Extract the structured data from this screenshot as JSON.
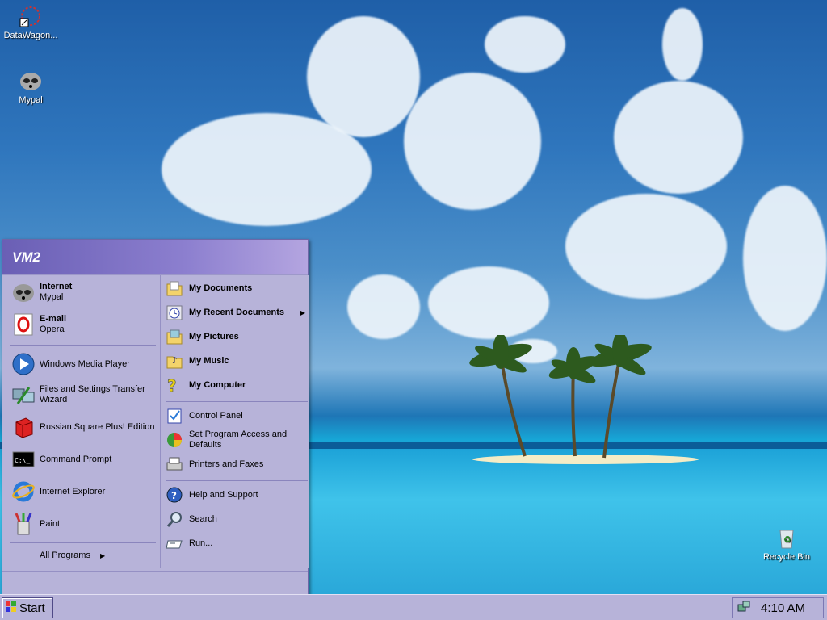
{
  "desktop": {
    "icons": [
      {
        "label": "DataWagon...",
        "icon": "datawagon-icon"
      },
      {
        "label": "Mypal",
        "icon": "mypal-icon"
      },
      {
        "label": "Recycle Bin",
        "icon": "recycle-bin-icon"
      }
    ]
  },
  "start_menu": {
    "user": "VM2",
    "pinned": [
      {
        "title": "Internet",
        "subtitle": "Mypal",
        "icon": "mypal-icon"
      },
      {
        "title": "E-mail",
        "subtitle": "Opera",
        "icon": "opera-icon"
      }
    ],
    "recent": [
      {
        "label": "Windows Media Player",
        "icon": "media-player-icon"
      },
      {
        "label": "Files and Settings Transfer Wizard",
        "icon": "transfer-wizard-icon"
      },
      {
        "label": "Russian Square Plus! Edition",
        "icon": "russian-square-icon"
      },
      {
        "label": "Command Prompt",
        "icon": "command-prompt-icon"
      },
      {
        "label": "Internet Explorer",
        "icon": "internet-explorer-icon"
      },
      {
        "label": "Paint",
        "icon": "paint-icon"
      }
    ],
    "all_programs": "All Programs",
    "right_top": [
      {
        "label": "My Documents",
        "icon": "folder-documents-icon"
      },
      {
        "label": "My Recent Documents",
        "icon": "recent-documents-icon"
      },
      {
        "label": "My Pictures",
        "icon": "folder-pictures-icon"
      },
      {
        "label": "My Music",
        "icon": "folder-music-icon"
      },
      {
        "label": "My Computer",
        "icon": "my-computer-icon"
      }
    ],
    "right_mid": [
      {
        "label": "Control Panel",
        "icon": "control-panel-icon"
      },
      {
        "label": "Set Program Access and Defaults",
        "icon": "program-defaults-icon"
      },
      {
        "label": "Printers and Faxes",
        "icon": "printer-icon"
      }
    ],
    "right_bottom": [
      {
        "label": "Help and Support",
        "icon": "help-icon"
      },
      {
        "label": "Search",
        "icon": "search-icon"
      },
      {
        "label": "Run...",
        "icon": "run-icon"
      }
    ]
  },
  "taskbar": {
    "start_label": "Start",
    "clock": "4:10 AM"
  }
}
